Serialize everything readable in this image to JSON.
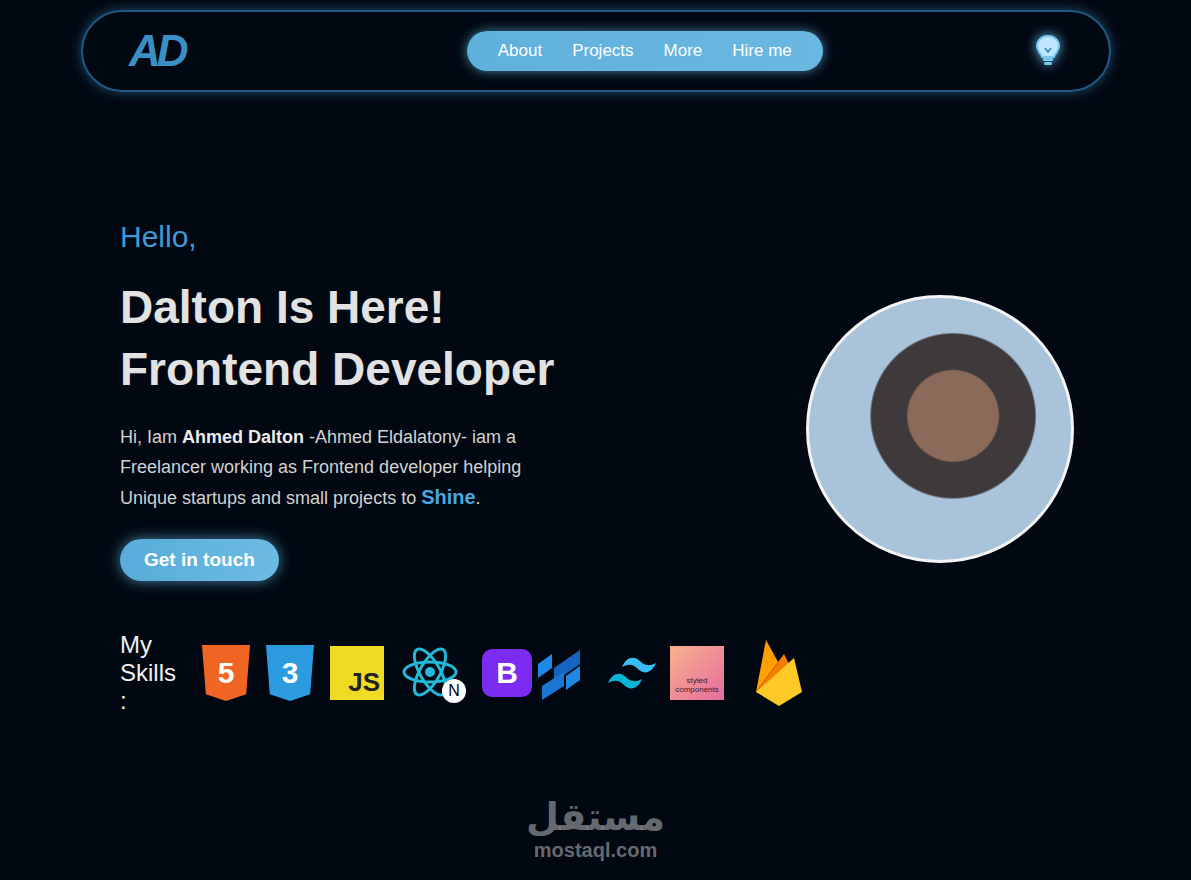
{
  "logo": "AD",
  "nav": {
    "links": [
      {
        "label": "About"
      },
      {
        "label": "Projects"
      },
      {
        "label": "More"
      },
      {
        "label": "Hire me"
      }
    ]
  },
  "hero": {
    "greeting": "Hello,",
    "headline": [
      "Dalton Is Here!",
      "Frontend Developer"
    ],
    "intro": [
      {
        "kind": "text",
        "text": "Hi, Iam "
      },
      {
        "kind": "bold",
        "text": "Ahmed Dalton"
      },
      {
        "kind": "text",
        "text": " -Ahmed Eldalatony- iam a Freelancer working as Frontend developer helping Unique startups and small projects to "
      },
      {
        "kind": "highlight",
        "text": "Shine"
      },
      {
        "kind": "text",
        "text": "."
      }
    ],
    "button": "Get in touch"
  },
  "skills": {
    "label": "My Skills :",
    "items": [
      {
        "kind": "html",
        "mark": "5"
      },
      {
        "kind": "css",
        "mark": "3"
      },
      {
        "kind": "js",
        "mark": "JS"
      },
      {
        "kind": "react",
        "mark": "N"
      },
      {
        "kind": "bootstrap",
        "mark": "B"
      },
      {
        "kind": "mui",
        "mark": ""
      },
      {
        "kind": "tailwind",
        "mark": ""
      },
      {
        "kind": "styled",
        "mark": "styled components"
      },
      {
        "kind": "firebase",
        "mark": ""
      }
    ]
  },
  "watermark": {
    "arabic": "مستقل",
    "latin": "mostaql.com"
  }
}
